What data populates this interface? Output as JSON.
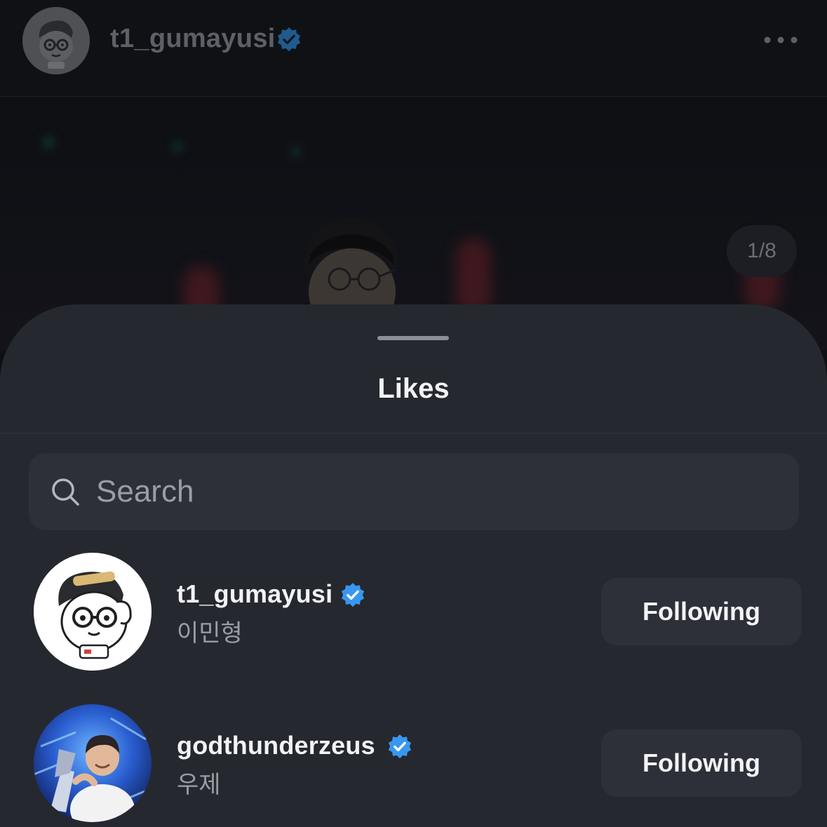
{
  "post": {
    "username": "t1_gumayusi",
    "page_counter": "1/8",
    "verified_icon": "verified-badge-icon",
    "more_icon": "more-options-icon"
  },
  "sheet": {
    "title": "Likes",
    "search": {
      "placeholder": "Search",
      "value": ""
    },
    "users": [
      {
        "username": "t1_gumayusi",
        "full_name": "이민형",
        "verified": true,
        "button_label": "Following"
      },
      {
        "username": "godthunderzeus",
        "full_name": "우제",
        "verified": true,
        "button_label": "Following"
      }
    ]
  },
  "colors": {
    "background": "#0e1014",
    "sheet": "#25282f",
    "button": "#2d3038",
    "verified_blue": "#3897f0",
    "secondary_text": "#9a9da3"
  }
}
